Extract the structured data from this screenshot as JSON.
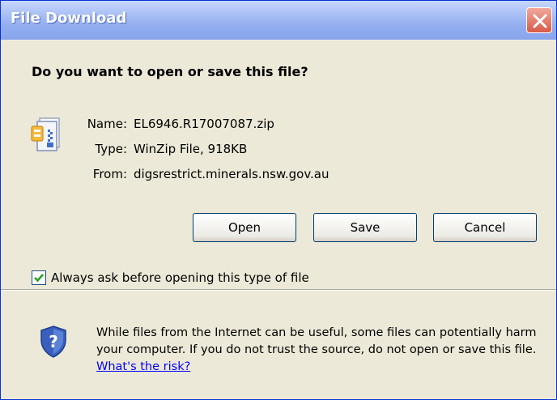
{
  "dialog": {
    "title": "File Download",
    "question": "Do you want to open or save this file?"
  },
  "file": {
    "name_label": "Name:",
    "name": "EL6946.R17007087.zip",
    "type_label": "Type:",
    "type": "WinZip File, 918KB",
    "from_label": "From:",
    "from": "digsrestrict.minerals.nsw.gov.au",
    "icon": "zip-file-icon"
  },
  "buttons": {
    "open": "Open",
    "save": "Save",
    "cancel": "Cancel"
  },
  "checkbox": {
    "label": "Always ask before opening this type of file",
    "checked": true
  },
  "warning": {
    "text": "While files from the Internet can be useful, some files can potentially harm your computer. If you do not trust the source, do not open or save this file.",
    "link": "What's the risk?",
    "icon": "shield-question-icon"
  },
  "colors": {
    "titlebar": "#93aef0",
    "dialog_bg": "#ece9d8",
    "close_button": "#d85a47",
    "link": "#0000ff"
  }
}
